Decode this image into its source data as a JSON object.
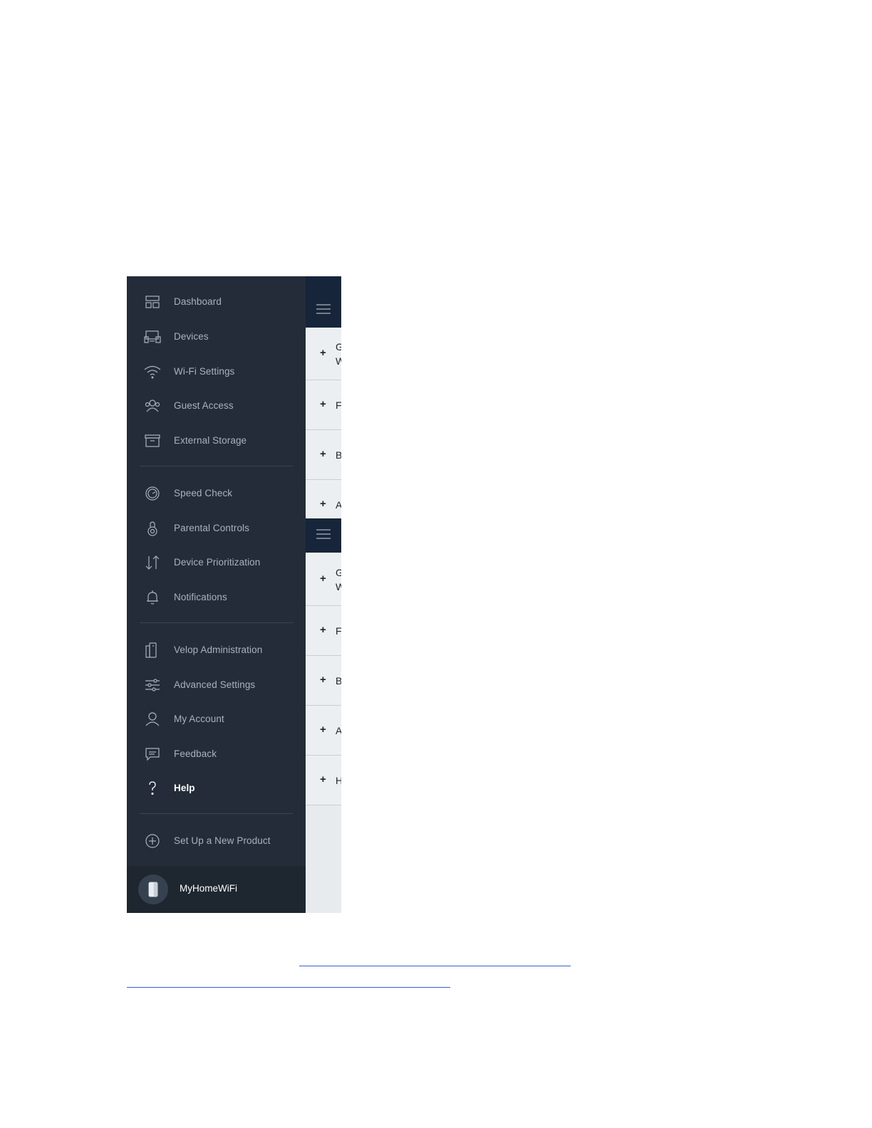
{
  "sidebar": {
    "items": [
      {
        "label": "Dashboard",
        "icon": "dashboard-icon"
      },
      {
        "label": "Devices",
        "icon": "devices-icon"
      },
      {
        "label": "Wi-Fi Settings",
        "icon": "wifi-icon"
      },
      {
        "label": "Guest Access",
        "icon": "guest-icon"
      },
      {
        "label": "External Storage",
        "icon": "storage-icon"
      },
      {
        "label": "Speed Check",
        "icon": "speedometer-icon"
      },
      {
        "label": "Parental Controls",
        "icon": "parental-controls-icon"
      },
      {
        "label": "Device Prioritization",
        "icon": "prioritization-arrows-icon"
      },
      {
        "label": "Notifications",
        "icon": "bell-icon"
      },
      {
        "label": "Velop Administration",
        "icon": "velop-nodes-icon"
      },
      {
        "label": "Advanced Settings",
        "icon": "sliders-icon"
      },
      {
        "label": "My Account",
        "icon": "user-icon"
      },
      {
        "label": "Feedback",
        "icon": "feedback-icon"
      },
      {
        "label": "Help",
        "icon": "help-icon",
        "active": true
      },
      {
        "label": "Set Up a New Product",
        "icon": "add-circle-icon"
      }
    ],
    "network_name": "MyHomeWiFi"
  },
  "panel": {
    "top_rows": [
      {
        "plus": "+",
        "text": "G\nW"
      },
      {
        "plus": "+",
        "text": "F"
      },
      {
        "plus": "+",
        "text": "B"
      },
      {
        "plus": "+",
        "text": "A"
      }
    ],
    "bottom_rows": [
      {
        "plus": "+",
        "text": "G\nW"
      },
      {
        "plus": "+",
        "text": "F"
      },
      {
        "plus": "+",
        "text": "B"
      },
      {
        "plus": "+",
        "text": "A"
      },
      {
        "plus": "+",
        "text": "H"
      }
    ]
  },
  "colors": {
    "sidebar_bg": "#232c38",
    "header_bg": "#17253a",
    "link": "#3a5fd0"
  }
}
